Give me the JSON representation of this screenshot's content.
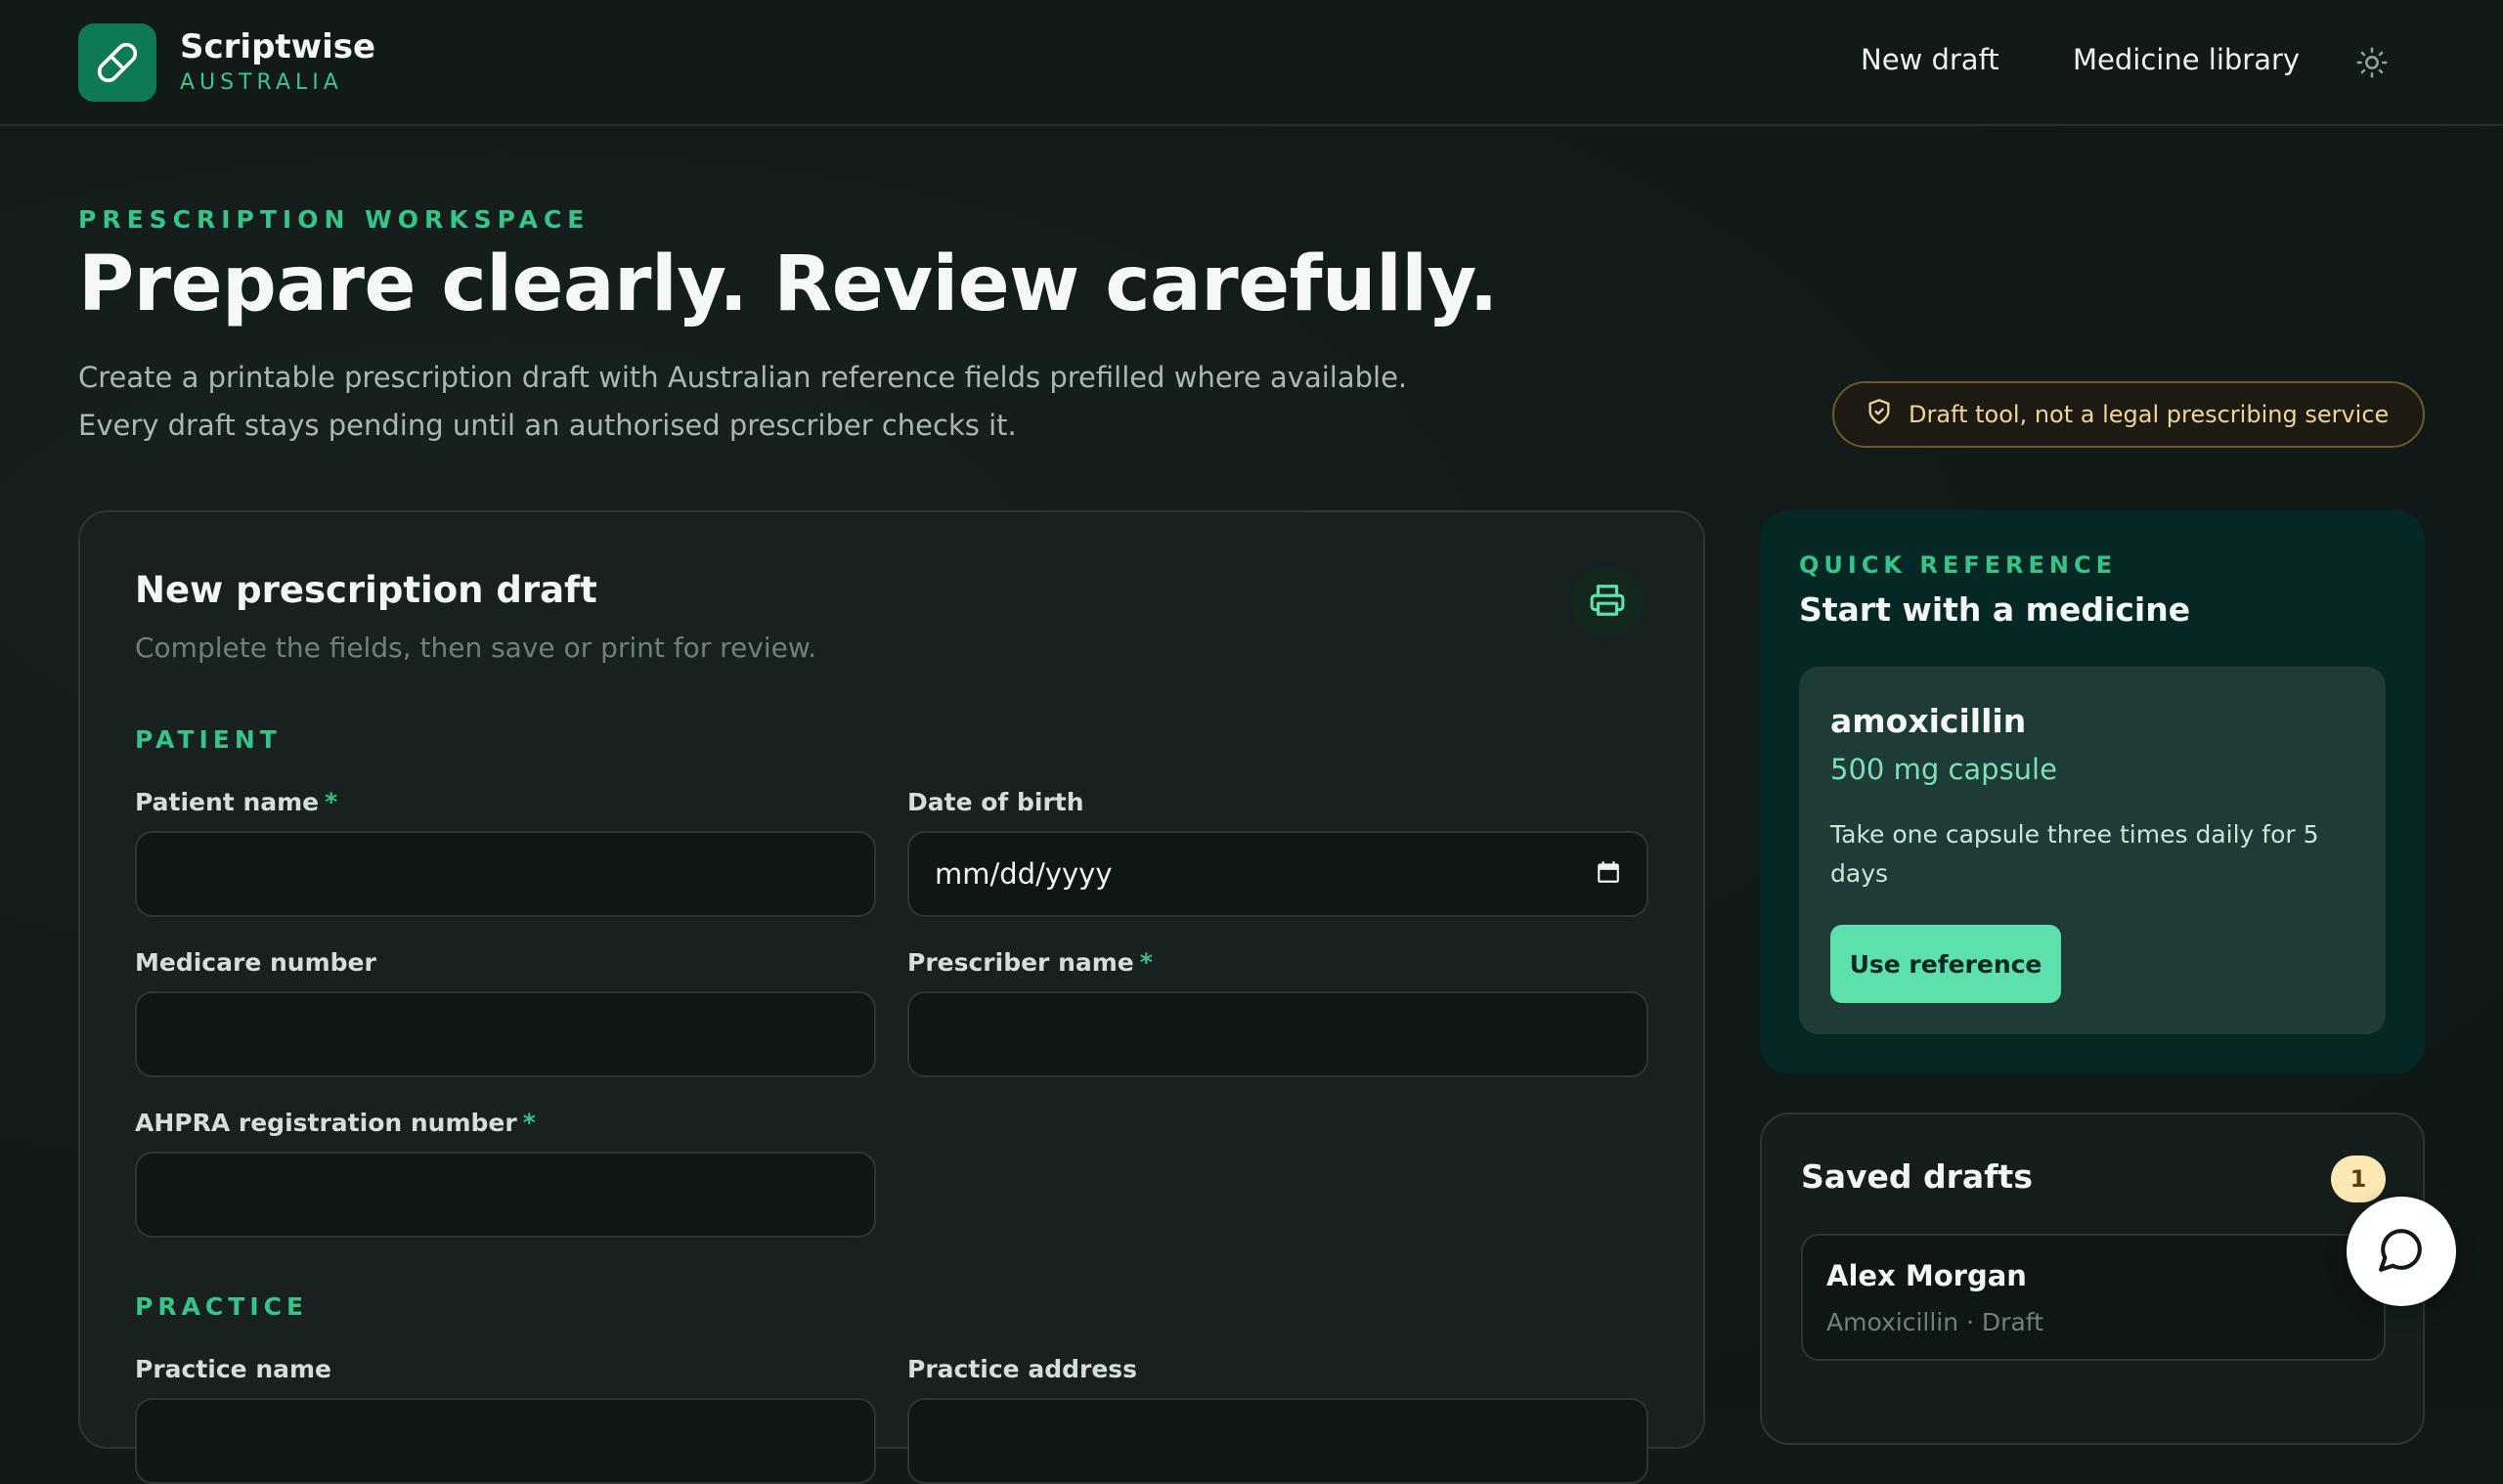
{
  "brand": {
    "name": "Scriptwise",
    "region": "AUSTRALIA",
    "logo_icon": "pill-icon",
    "accent_color": "#0e7a55"
  },
  "nav": {
    "new_draft": "New draft",
    "medicine_library": "Medicine library",
    "theme_icon": "sun-icon"
  },
  "hero": {
    "eyebrow": "PRESCRIPTION WORKSPACE",
    "title": "Prepare clearly. Review carefully.",
    "description_line1": "Create a printable prescription draft with Australian reference fields prefilled where available.",
    "description_line2": "Every draft stays pending until an authorised prescriber checks it.",
    "disclaimer": "Draft tool, not a legal prescribing service"
  },
  "form": {
    "title": "New prescription draft",
    "subtitle": "Complete the fields, then save or print for review.",
    "patient_section": "PATIENT",
    "practice_section": "PRACTICE",
    "required_marker": "*",
    "fields": {
      "patient_name": {
        "label": "Patient name",
        "value": ""
      },
      "date_of_birth": {
        "label": "Date of birth",
        "placeholder": "mm/dd/yyyy"
      },
      "medicare_number": {
        "label": "Medicare number",
        "value": ""
      },
      "prescriber_name": {
        "label": "Prescriber name",
        "value": ""
      },
      "ahpra_number": {
        "label": "AHPRA registration number",
        "value": ""
      },
      "practice_name": {
        "label": "Practice name",
        "value": ""
      },
      "practice_address": {
        "label": "Practice address",
        "value": ""
      }
    }
  },
  "quick_reference": {
    "eyebrow": "QUICK REFERENCE",
    "title": "Start with a medicine",
    "medicine": {
      "name": "amoxicillin",
      "strength": "500 mg capsule",
      "directions": "Take one capsule three times daily for 5 days"
    },
    "use_button": "Use reference"
  },
  "saved_drafts": {
    "title": "Saved drafts",
    "count": "1",
    "items": [
      {
        "name": "Alex Morgan",
        "meta": "Amoxicillin · Draft"
      }
    ]
  },
  "chat": {
    "icon": "chat-bubble-icon"
  }
}
